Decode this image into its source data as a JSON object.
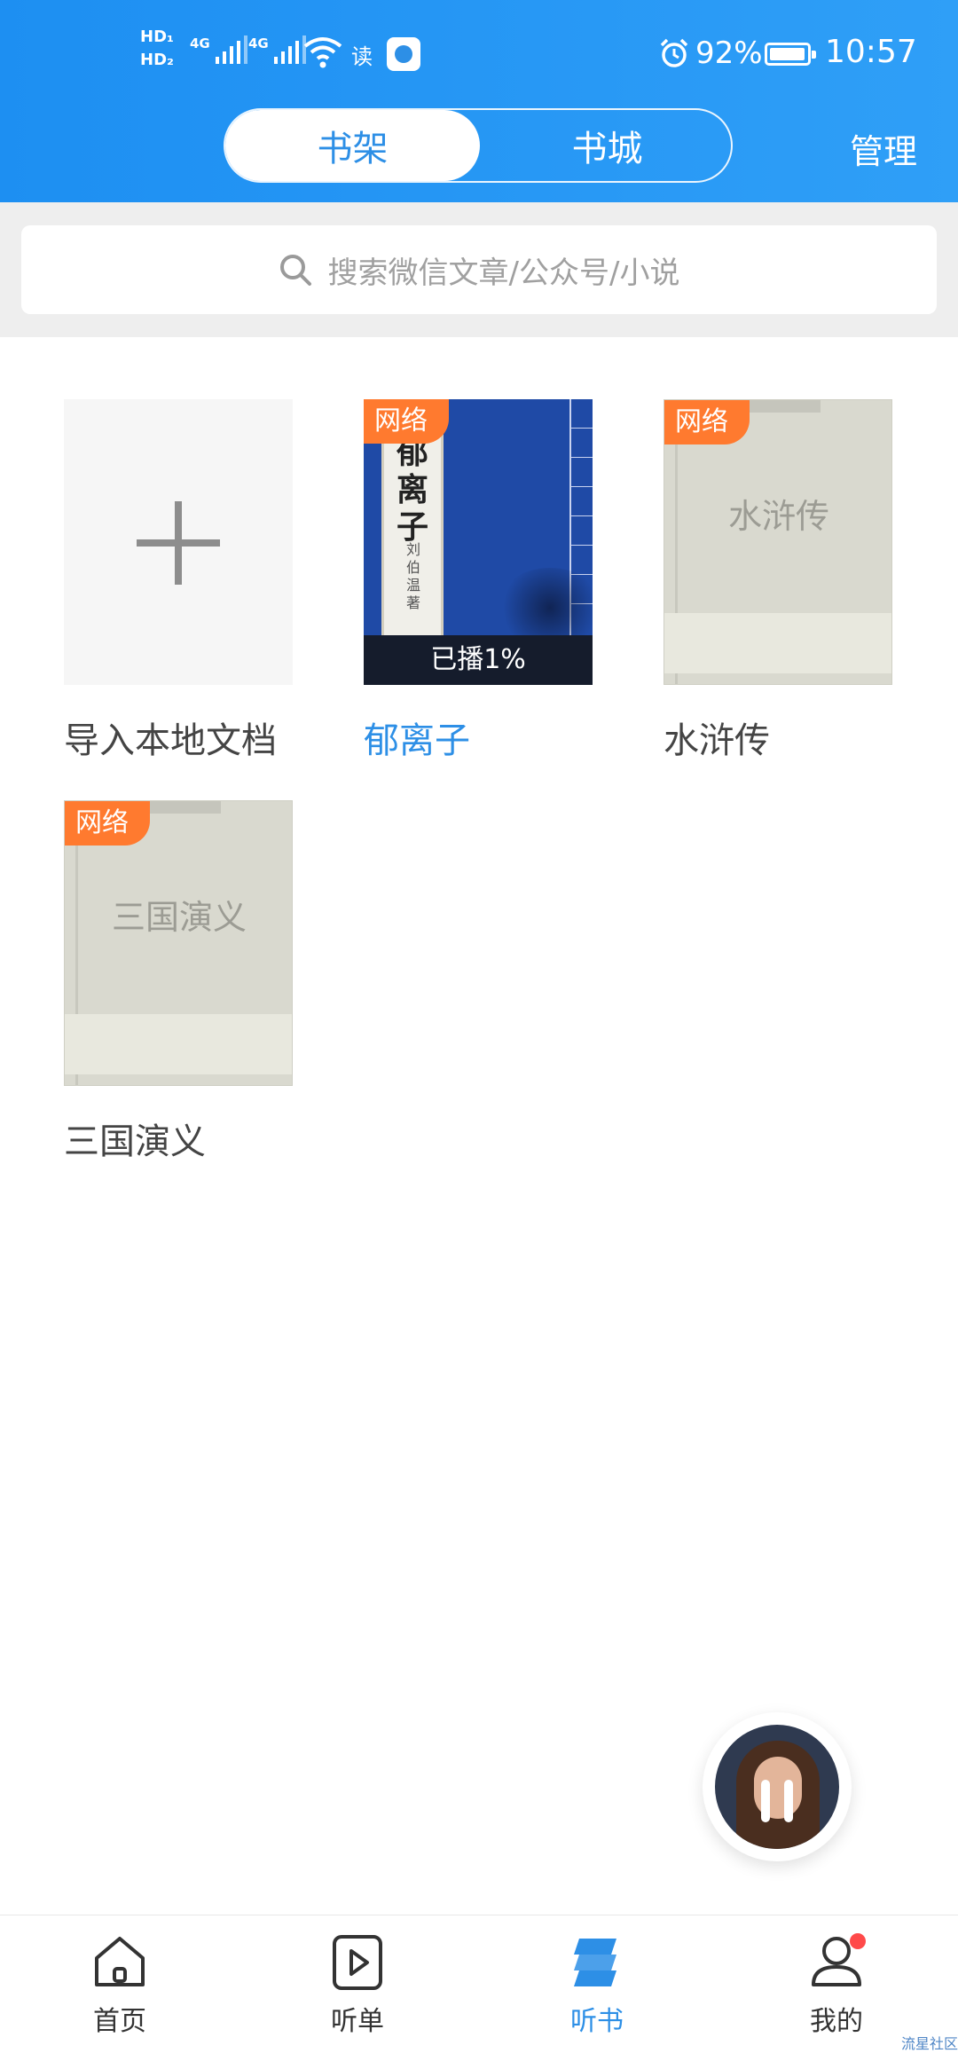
{
  "status_bar": {
    "hd1": "HD₁",
    "hd2": "HD₂",
    "network1": "4G",
    "network2": "4G",
    "read_label": "读",
    "battery": "92%",
    "time": "10:57"
  },
  "header": {
    "tabs": [
      {
        "label": "书架",
        "active": true
      },
      {
        "label": "书城",
        "active": false
      }
    ],
    "manage_label": "管理"
  },
  "search": {
    "placeholder": "搜索微信文章/公众号/小说"
  },
  "shelf": {
    "import": {
      "title": "导入本地文档"
    },
    "books": [
      {
        "title": "郁离子",
        "tag": "网络",
        "cover_title": "郁离子",
        "cover_subtitle": "刘伯温著",
        "progress": "已播1%",
        "highlight": true
      },
      {
        "title": "水浒传",
        "tag": "网络",
        "cover_title": "水浒传"
      },
      {
        "title": "三国演义",
        "tag": "网络",
        "cover_title": "三国演义"
      }
    ]
  },
  "bottom_nav": [
    {
      "label": "首页",
      "icon": "home-icon"
    },
    {
      "label": "听单",
      "icon": "play-icon"
    },
    {
      "label": "听书",
      "icon": "book-stack-icon",
      "active": true
    },
    {
      "label": "我的",
      "icon": "user-icon",
      "badge": true
    }
  ],
  "watermark": "流星社区",
  "colors": {
    "brand_blue": "#2d8fe6",
    "tag_orange": "#ff7a2f",
    "badge_red": "#ff4a4a"
  }
}
